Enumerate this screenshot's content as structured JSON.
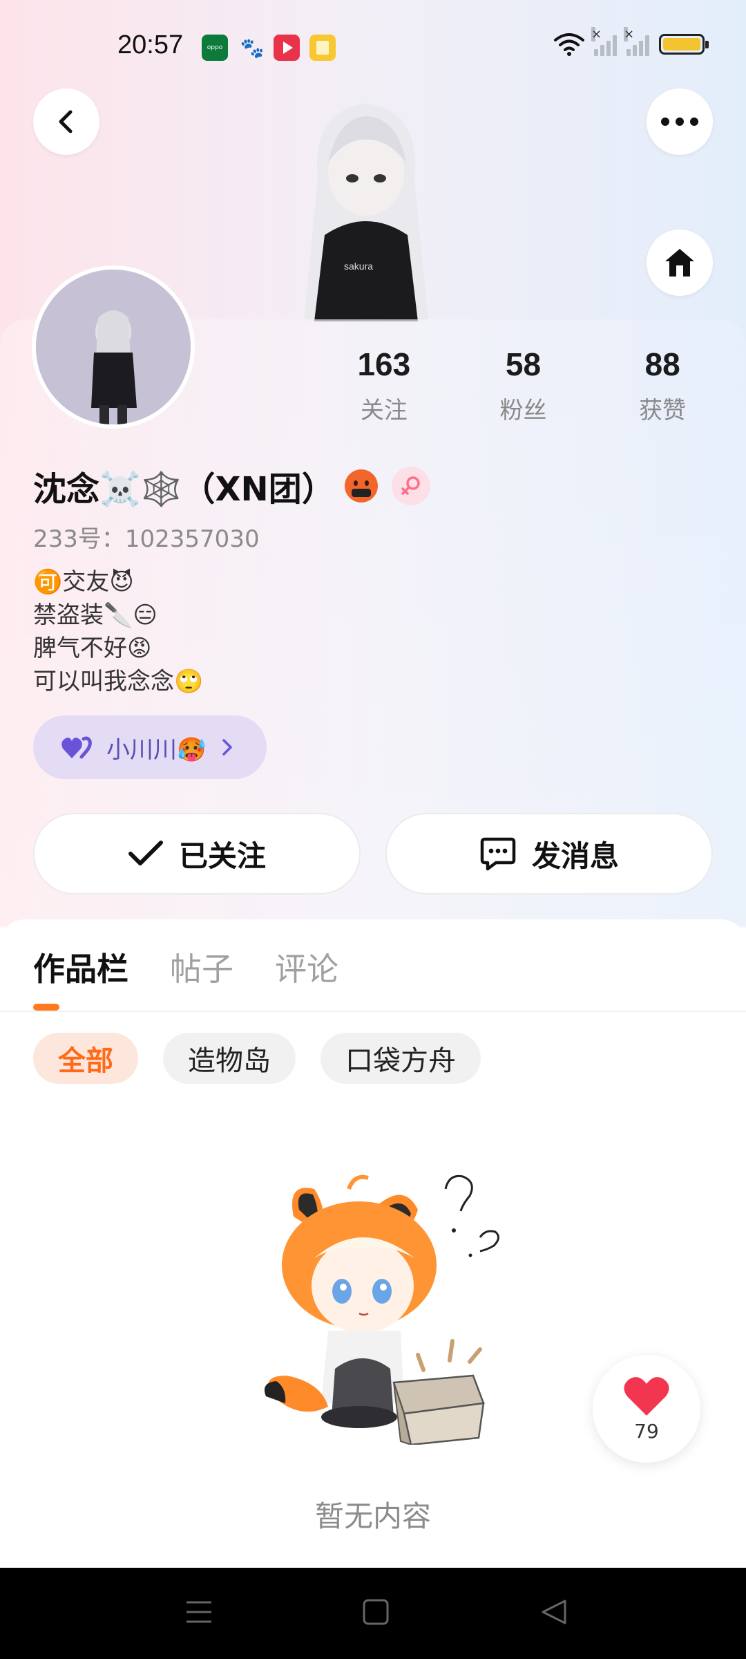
{
  "status_bar": {
    "time": "20:57",
    "apps": [
      "oppo-icon",
      "baidu-icon",
      "video-icon",
      "reader-icon"
    ],
    "battery_level": 0.9
  },
  "header": {
    "back_icon": "chevron-left-icon",
    "more_icon": "more-dots-icon",
    "home_icon": "home-icon"
  },
  "profile": {
    "stats": [
      {
        "value": "163",
        "label": "关注"
      },
      {
        "value": "58",
        "label": "粉丝"
      },
      {
        "value": "88",
        "label": "获赞"
      }
    ],
    "name": "沈念☠️🕸️（XN团）",
    "id_text": "233号：102357030",
    "bio": [
      "🉑交友😈",
      "禁盗装🔪😑",
      "脾气不好😡",
      "可以叫我念念🙄"
    ],
    "cp_tag": "小川川🥵"
  },
  "actions": {
    "follow_label": "已关注",
    "message_label": "发消息"
  },
  "tabs": [
    "作品栏",
    "帖子",
    "评论"
  ],
  "filters": [
    "全部",
    "造物岛",
    "口袋方舟"
  ],
  "empty_text": "暂无内容",
  "like_float": {
    "count": "79"
  },
  "colors": {
    "accent": "#ff7a1e",
    "cp_tag_bg": "#e4dcf5",
    "cp_tag_text": "#5c4fb3",
    "like_heart": "#f3364f"
  }
}
